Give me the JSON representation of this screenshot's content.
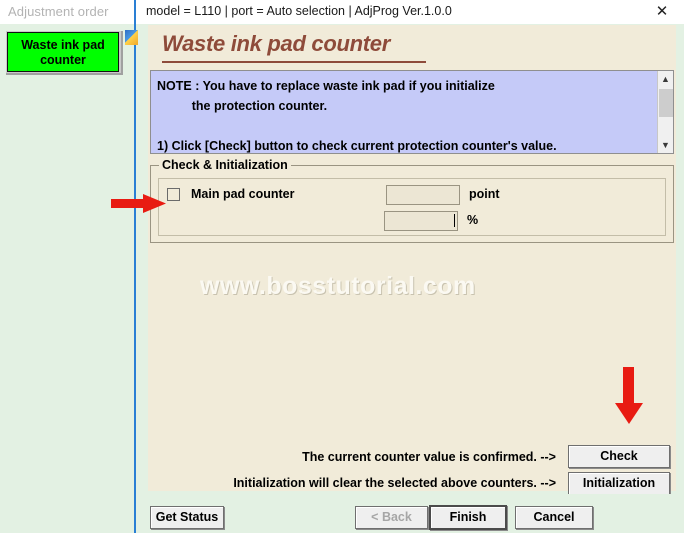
{
  "sidebar": {
    "header_label": "Adjustment order",
    "selected_item": "Waste ink pad\ncounter"
  },
  "window": {
    "title": "model = L110 | port = Auto selection | AdjProg Ver.1.0.0",
    "close_icon": "close-icon"
  },
  "page": {
    "heading": "Waste ink pad counter",
    "watermark": "www.bosstutorial.com"
  },
  "note": {
    "text": "NOTE : You have to replace waste ink pad if you initialize\n          the protection counter.\n\n1) Click [Check] button to check current protection counter's value.",
    "scroll_up_icon": "chevron-up-icon",
    "scroll_down_icon": "chevron-down-icon"
  },
  "group": {
    "title": "Check & Initialization",
    "counter": {
      "label": "Main pad counter",
      "checked": false,
      "point_value": "",
      "point_unit": "point",
      "percent_value": "",
      "percent_unit": "%"
    }
  },
  "actions": {
    "hint_check": "The current counter value is confirmed. -->",
    "hint_init": "Initialization will clear the selected above counters. -->",
    "check_label": "Check",
    "init_label": "Initialization"
  },
  "wizard": {
    "get_status_label": "Get Status",
    "back_label": "< Back",
    "finish_label": "Finish",
    "cancel_label": "Cancel"
  },
  "annotations": {
    "arrow_to_checkbox": "red-arrow-right-icon",
    "arrow_to_check_button": "red-arrow-down-icon"
  },
  "colors": {
    "selected_item_bg": "#00ff00",
    "panel_bg": "#f1ebd9",
    "note_bg": "#c5caf8",
    "heading": "#8e4b3a",
    "app_bg": "#e3f1e3",
    "annotation": "#e81b12"
  }
}
